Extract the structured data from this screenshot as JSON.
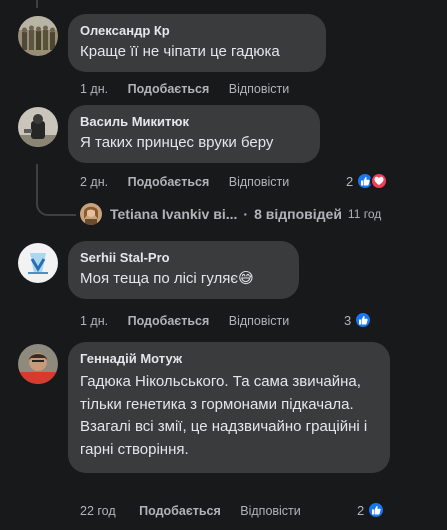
{
  "colors": {
    "background": "#18191a",
    "bubble": "#3a3b3c",
    "text": "#e4e6eb",
    "secondary": "#b0b3b8",
    "like": "#1877f2",
    "love": "#f33e58"
  },
  "comments": [
    {
      "author": "Олександр Кр",
      "text": "Краще її не чіпати це гадюка",
      "time": "1 дн.",
      "like_label": "Подобається",
      "reply_label": "Відповісти"
    },
    {
      "author": "Василь Микитюк",
      "text": "Я таких принцес вруки беру",
      "time": "2 дн.",
      "like_label": "Подобається",
      "reply_label": "Відповісти",
      "reaction_count": "2",
      "reaction_icons": [
        "like-icon",
        "love-icon"
      ]
    },
    {
      "author": "Serhii Stal-Pro",
      "text": "Моя теща по лісі гуляє",
      "emoji": "😅",
      "time": "1 дн.",
      "like_label": "Подобається",
      "reply_label": "Відповісти",
      "reaction_count": "3",
      "reaction_icons": [
        "like-icon"
      ]
    },
    {
      "author": "Геннадій Мотуж",
      "text": "Гадюка Нікольського. Та сама звичайна, тільки генетика з гормонами підкачала. Взагалі всі змії, це надзвичайно граційні і гарні створіння.",
      "time": "22 год",
      "like_label": "Подобається",
      "reply_label": "Відповісти",
      "reaction_count": "2",
      "reaction_icons": [
        "like-icon"
      ]
    }
  ],
  "replies": {
    "name": "Tetiana Ivankiv ві...",
    "separator": "·",
    "count": "8 відповідей",
    "time": "11 год"
  }
}
